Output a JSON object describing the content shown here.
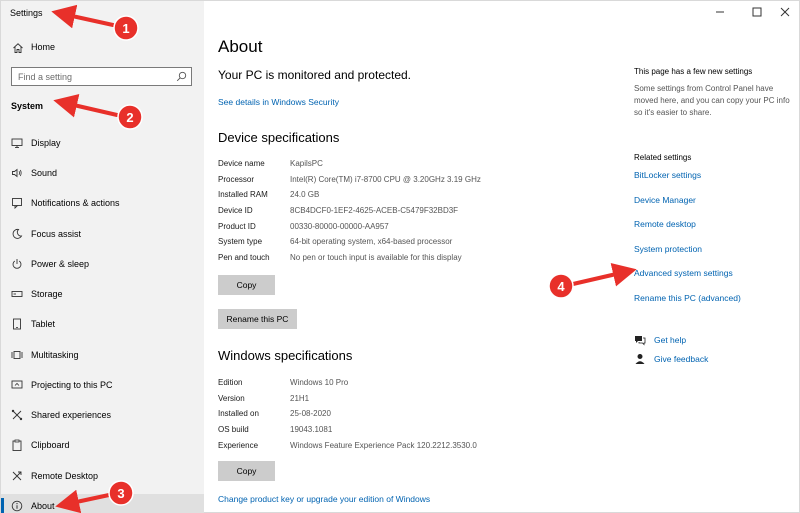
{
  "app": {
    "title": "Settings"
  },
  "window_controls": {
    "minimize_icon": "minimize-icon",
    "maximize_icon": "maximize-icon",
    "close_icon": "close-icon"
  },
  "sidebar": {
    "home_label": "Home",
    "search_placeholder": "Find a setting",
    "section_header": "System",
    "items": [
      {
        "label": "Display",
        "icon": "monitor-icon"
      },
      {
        "label": "Sound",
        "icon": "speaker-icon"
      },
      {
        "label": "Notifications & actions",
        "icon": "notification-icon"
      },
      {
        "label": "Focus assist",
        "icon": "moon-icon"
      },
      {
        "label": "Power & sleep",
        "icon": "power-icon"
      },
      {
        "label": "Storage",
        "icon": "storage-icon"
      },
      {
        "label": "Tablet",
        "icon": "tablet-icon"
      },
      {
        "label": "Multitasking",
        "icon": "multitasking-icon"
      },
      {
        "label": "Projecting to this PC",
        "icon": "projector-icon"
      },
      {
        "label": "Shared experiences",
        "icon": "shared-icon"
      },
      {
        "label": "Clipboard",
        "icon": "clipboard-icon"
      },
      {
        "label": "Remote Desktop",
        "icon": "remote-icon"
      },
      {
        "label": "About",
        "icon": "info-icon"
      }
    ]
  },
  "main": {
    "title": "About",
    "protection_text": "Your PC is monitored and protected.",
    "security_link": "See details in Windows Security",
    "device_specs": {
      "title": "Device specifications",
      "rows": [
        {
          "key": "Device name",
          "value": "KapilsPC"
        },
        {
          "key": "Processor",
          "value": "Intel(R) Core(TM) i7-8700 CPU @ 3.20GHz   3.19 GHz"
        },
        {
          "key": "Installed RAM",
          "value": "24.0 GB"
        },
        {
          "key": "Device ID",
          "value": "8CB4DCF0-1EF2-4625-ACEB-C5479F32BD3F"
        },
        {
          "key": "Product ID",
          "value": "00330-80000-00000-AA957"
        },
        {
          "key": "System type",
          "value": "64-bit operating system, x64-based processor"
        },
        {
          "key": "Pen and touch",
          "value": "No pen or touch input is available for this display"
        }
      ],
      "copy_label": "Copy",
      "rename_label": "Rename this PC"
    },
    "windows_specs": {
      "title": "Windows specifications",
      "rows": [
        {
          "key": "Edition",
          "value": "Windows 10 Pro"
        },
        {
          "key": "Version",
          "value": "21H1"
        },
        {
          "key": "Installed on",
          "value": "25-08-2020"
        },
        {
          "key": "OS build",
          "value": "19043.1081"
        },
        {
          "key": "Experience",
          "value": "Windows Feature Experience Pack 120.2212.3530.0"
        }
      ],
      "copy_label": "Copy",
      "change_key_link": "Change product key or upgrade your edition of Windows"
    }
  },
  "right_panel": {
    "note_title": "This page has a few new settings",
    "note_desc": "Some settings from Control Panel have moved here, and you can copy your PC info so it's easier to share.",
    "related_header": "Related settings",
    "related_links": [
      "BitLocker settings",
      "Device Manager",
      "Remote desktop",
      "System protection",
      "Advanced system settings",
      "Rename this PC (advanced)"
    ],
    "help_label": "Get help",
    "feedback_label": "Give feedback"
  },
  "annotations": [
    {
      "number": "1"
    },
    {
      "number": "2"
    },
    {
      "number": "3"
    },
    {
      "number": "4"
    }
  ],
  "colors": {
    "link": "#0063b1",
    "sidebar_bg": "#f2f2f2",
    "button_bg": "#cccccc",
    "annotation_red": "#e8302a"
  }
}
